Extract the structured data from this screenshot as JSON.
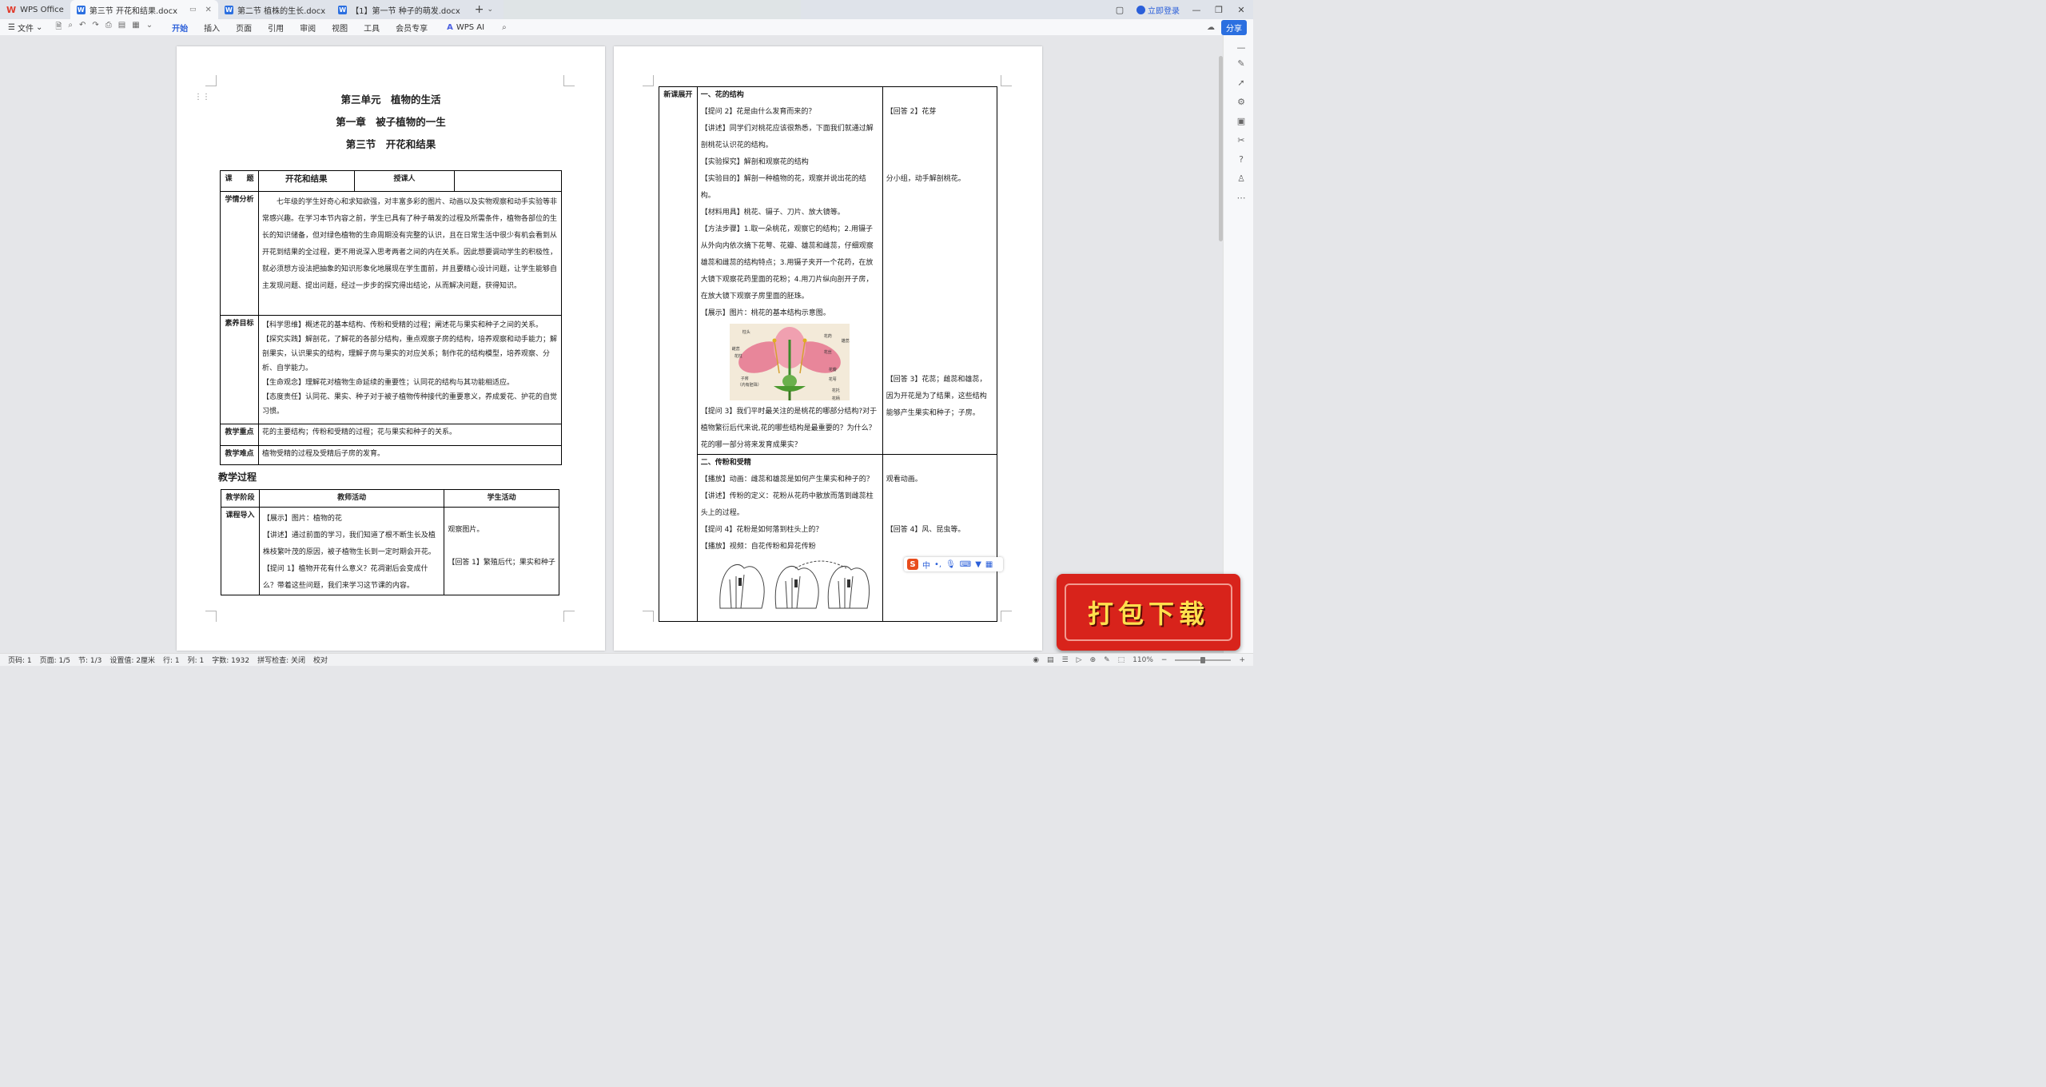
{
  "titlebar": {
    "app_tab": "WPS Office",
    "tabs": [
      {
        "label": "第三节  开花和结果.docx"
      },
      {
        "label": "第二节  植株的生长.docx"
      },
      {
        "label": "【1】第一节  种子的萌发.docx"
      }
    ],
    "new_tab": "+",
    "login": "立即登录"
  },
  "toolbar": {
    "file": "文件",
    "menus": [
      "开始",
      "插入",
      "页面",
      "引用",
      "审阅",
      "视图",
      "工具",
      "会员专享"
    ],
    "wps_ai": "WPS AI",
    "share": "分享"
  },
  "page1": {
    "heading1": "第三单元　植物的生活",
    "heading2": "第一章　被子植物的一生",
    "heading3": "第三节　开花和结果",
    "info_table": {
      "topic_label": "课　　题",
      "topic_value": "开花和结果",
      "teacher_label": "授课人",
      "teacher_value": "",
      "analysis_label": "学情分析",
      "analysis_text": "七年级的学生好奇心和求知欲强，对丰富多彩的图片、动画以及实物观察和动手实验等非常感兴趣。在学习本节内容之前，学生已具有了种子萌发的过程及所需条件，植物各部位的生长的知识储备，但对绿色植物的生命周期没有完整的认识，且在日常生活中很少有机会看到从开花到结果的全过程，更不用说深入思考两者之间的内在关系。因此想要调动学生的积极性，就必须想方设法把抽象的知识形象化地展现在学生面前，并且要精心设计问题，让学生能够自主发现问题、提出问题，经过一步步的探究得出结论，从而解决问题，获得知识。",
      "goals_label": "素养目标",
      "goals": [
        "【科学思维】概述花的基本结构、传粉和受精的过程；阐述花与果实和种子之间的关系。",
        "【探究实践】解剖花，了解花的各部分结构，重点观察子房的结构，培养观察和动手能力；解剖果实，认识果实的结构，理解子房与果实的对应关系；制作花的结构模型，培养观察、分析、自学能力。",
        "【生命观念】理解花对植物生命延续的重要性；认同花的结构与其功能相适应。",
        "【态度责任】认同花、果实、种子对于被子植物传种接代的重要意义，养成爱花、护花的自觉习惯。"
      ],
      "key_label": "教学重点",
      "key_text": "花的主要结构；传粉和受精的过程；花与果实和种子的关系。",
      "difficult_label": "教学难点",
      "difficult_text": "植物受精的过程及受精后子房的发育。"
    },
    "process_title": "教学过程",
    "process_table": {
      "headers": [
        "教学阶段",
        "教师活动",
        "学生活动"
      ],
      "stage": "课程导入",
      "teacher": [
        "【展示】图片：植物的花",
        "【讲述】通过前面的学习，我们知道了根不断生长及植株枝繁叶茂的原因，被子植物生长到一定时期会开花。",
        "【提问 1】植物开花有什么意义？花凋谢后会变成什么？带着这些问题，我们来学习这节课的内容。"
      ],
      "student": [
        "观察图片。",
        "【回答 1】繁殖后代；果实和种子"
      ]
    }
  },
  "page2": {
    "stage": "新课展开",
    "section1": {
      "title": "一、花的结构",
      "teacher": [
        "【提问 2】花是由什么发育而来的？",
        "【讲述】同学们对桃花应该很熟悉，下面我们就通过解剖桃花认识花的结构。",
        "【实验探究】解剖和观察花的结构",
        "【实验目的】解剖一种植物的花，观察并说出花的结构。",
        "【材料用具】桃花、镊子、刀片、放大镜等。",
        "【方法步骤】1.取一朵桃花，观察它的结构；2.用镊子从外向内依次摘下花萼、花瓣、雄蕊和雌蕊，仔细观察雄蕊和雌蕊的结构特点；3.用镊子夹开一个花药，在放大镜下观察花药里面的花粉；4.用刀片纵向剖开子房，在放大镜下观察子房里面的胚珠。",
        "【展示】图片：桃花的基本结构示意图。",
        "【提问 3】我们平时最关注的是桃花的哪部分结构?对于植物繁衍后代来说,花的哪些结构是最重要的？为什么？花的哪一部分将来发育成果实？"
      ],
      "student": [
        "【回答 2】花芽",
        "分小组，动手解剖桃花。",
        "【回答 3】花蕊；雌蕊和雄蕊，因为开花是为了结果，这些结构能够产生果实和种子；子房。"
      ],
      "diagram_labels": [
        "柱头",
        "花柱",
        "子房",
        "（内有胚珠）",
        "花药",
        "花丝",
        "雌蕊",
        "雄蕊",
        "花瓣",
        "花萼",
        "花托",
        "花柄"
      ]
    },
    "section2": {
      "title": "二、传粉和受精",
      "teacher": [
        "【播放】动画：雌蕊和雄蕊是如何产生果实和种子的？",
        "【讲述】传粉的定义：花粉从花药中散放而落到雌蕊柱头上的过程。",
        "【提问 4】花粉是如何落到柱头上的？",
        "【播放】视频：自花传粉和异花传粉"
      ],
      "student": [
        "观看动画。",
        "【回答 4】风、昆虫等。"
      ]
    }
  },
  "ime": {
    "label": "中"
  },
  "banner": {
    "text": "打包下载"
  },
  "statusbar": {
    "items": [
      "页码: 1",
      "页面: 1/5",
      "节: 1/3",
      "设置值: 2厘米",
      "行: 1",
      "列: 1",
      "字数: 1932",
      "拼写检查: 关闭",
      "校对"
    ],
    "zoom": "110%"
  }
}
